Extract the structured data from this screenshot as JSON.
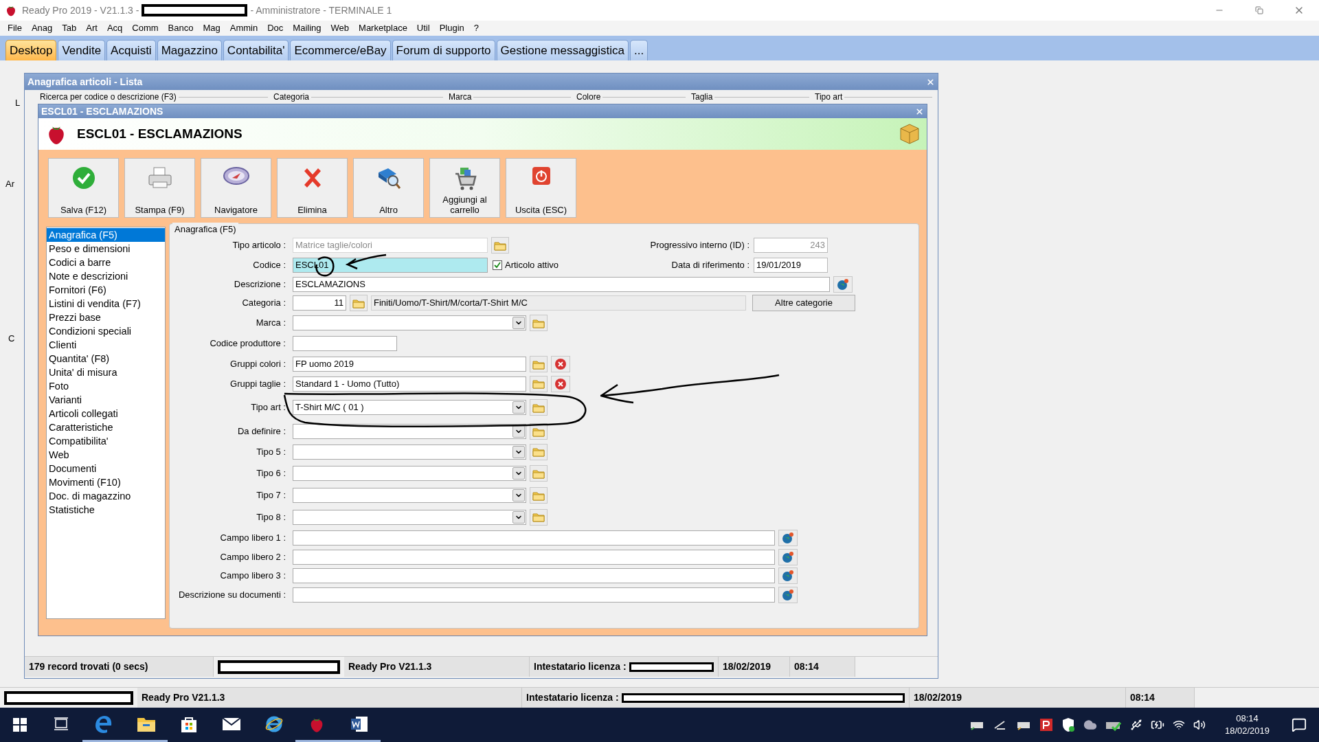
{
  "window": {
    "title_left": "Ready Pro 2019 - V21.1.3 -",
    "title_right": "- Amministratore - TERMINALE 1"
  },
  "menu": [
    "File",
    "Anag",
    "Tab",
    "Art",
    "Acq",
    "Comm",
    "Banco",
    "Mag",
    "Ammin",
    "Doc",
    "Mailing",
    "Web",
    "Marketplace",
    "Util",
    "Plugin",
    "?"
  ],
  "tabs": [
    {
      "label": "Desktop",
      "selected": true
    },
    {
      "label": "Vendite",
      "selected": false
    },
    {
      "label": "Acquisti",
      "selected": false
    },
    {
      "label": "Magazzino",
      "selected": false
    },
    {
      "label": "Contabilita'",
      "selected": false
    },
    {
      "label": "Ecommerce/eBay",
      "selected": false
    },
    {
      "label": "Forum di supporto",
      "selected": false
    },
    {
      "label": "Gestione messaggistica",
      "selected": false
    },
    {
      "label": "...",
      "selected": false
    }
  ],
  "desktop_fragments": [
    "L",
    "Ar",
    "C"
  ],
  "list_window": {
    "title": "Anagrafica articoli  - Lista",
    "filters": [
      "Ricerca per codice o descrizione (F3)",
      "Categoria",
      "Marca",
      "Colore",
      "Taglia",
      "Tipo art"
    ],
    "status": [
      {
        "kind": "text",
        "text": "179 record trovati (0 secs)"
      },
      {
        "kind": "redacted"
      },
      {
        "kind": "text",
        "text": "Ready Pro V21.1.3"
      },
      {
        "kind": "licence",
        "text": "Intestatario licenza :"
      },
      {
        "kind": "text",
        "text": "18/02/2019"
      },
      {
        "kind": "text",
        "text": "08:14"
      }
    ]
  },
  "dialog": {
    "title": "ESCL01 - ESCLAMAZIONS",
    "header": "ESCL01 - ESCLAMAZIONS",
    "toolbar": [
      {
        "kind": "save",
        "label": "Salva (F12)"
      },
      {
        "kind": "print",
        "label": "Stampa (F9)"
      },
      {
        "kind": "navigator",
        "label": "Navigatore"
      },
      {
        "kind": "delete",
        "label": "Elimina"
      },
      {
        "kind": "more",
        "label": "Altro"
      },
      {
        "kind": "cart",
        "label": "Aggiungi al carrello"
      },
      {
        "kind": "exit",
        "label": "Uscita (ESC)"
      }
    ],
    "sections": [
      {
        "label": "Anagrafica (F5)",
        "selected": true
      },
      {
        "label": "Peso e dimensioni",
        "selected": false
      },
      {
        "label": "Codici a barre",
        "selected": false
      },
      {
        "label": "Note e descrizioni",
        "selected": false
      },
      {
        "label": "Fornitori (F6)",
        "selected": false
      },
      {
        "label": "Listini di vendita (F7)",
        "selected": false
      },
      {
        "label": "Prezzi base",
        "selected": false
      },
      {
        "label": "Condizioni speciali",
        "selected": false
      },
      {
        "label": "Clienti",
        "selected": false
      },
      {
        "label": "Quantita' (F8)",
        "selected": false
      },
      {
        "label": "Unita' di misura",
        "selected": false
      },
      {
        "label": "Foto",
        "selected": false
      },
      {
        "label": "Varianti",
        "selected": false
      },
      {
        "label": "Articoli collegati",
        "selected": false
      },
      {
        "label": "Caratteristiche",
        "selected": false
      },
      {
        "label": "Compatibilita'",
        "selected": false
      },
      {
        "label": "Web",
        "selected": false
      },
      {
        "label": "Documenti",
        "selected": false
      },
      {
        "label": "Movimenti (F10)",
        "selected": false
      },
      {
        "label": "Doc. di magazzino",
        "selected": false
      },
      {
        "label": "Statistiche",
        "selected": false
      }
    ],
    "group_title": "Anagrafica (F5)",
    "fields": [
      {
        "kind": "text",
        "label": "Tipo articolo :",
        "value": "Matrice taglie/colori",
        "readonly": true,
        "focused": false,
        "buttons": [
          {
            "kind": "folder"
          }
        ]
      },
      {
        "kind": "text",
        "label": "Codice :",
        "value": "ESCL01",
        "readonly": false,
        "focused": true,
        "checkbox": {
          "label": "Articolo attivo",
          "checked": true
        }
      },
      {
        "kind": "text",
        "label": "Descrizione :",
        "value": "ESCLAMAZIONS",
        "readonly": false,
        "focused": false,
        "buttons": [
          {
            "kind": "globe"
          }
        ]
      },
      {
        "kind": "category",
        "label": "Categoria :",
        "number": "11",
        "path": "Finiti/Uomo/T-Shirt/M/corta/T-Shirt M/C",
        "action": "Altre categorie",
        "readonly": false,
        "focused": false
      },
      {
        "kind": "combo",
        "label": "Marca :",
        "readonly": false,
        "focused": false,
        "buttons": [
          {
            "kind": "folder"
          }
        ]
      },
      {
        "kind": "text",
        "label": "Codice produttore :",
        "readonly": false,
        "focused": false
      },
      {
        "kind": "text",
        "label": "Gruppi colori :",
        "value": "FP uomo 2019",
        "readonly": false,
        "focused": false,
        "buttons": [
          {
            "kind": "folder"
          },
          {
            "kind": "clear"
          }
        ]
      },
      {
        "kind": "text",
        "label": "Gruppi taglie :",
        "value": "Standard 1 - Uomo (Tutto)",
        "readonly": false,
        "focused": false,
        "buttons": [
          {
            "kind": "folder"
          },
          {
            "kind": "clear"
          }
        ]
      },
      {
        "kind": "combo",
        "label": "Tipo art :",
        "value": "T-Shirt M/C ( 01 )",
        "readonly": false,
        "focused": false,
        "buttons": [
          {
            "kind": "folder"
          }
        ]
      },
      {
        "kind": "combo",
        "label": "Da definire :",
        "readonly": false,
        "focused": false,
        "buttons": [
          {
            "kind": "folder"
          }
        ]
      },
      {
        "kind": "combo",
        "label": "Tipo 5 :",
        "readonly": false,
        "focused": false,
        "buttons": [
          {
            "kind": "folder"
          }
        ]
      },
      {
        "kind": "combo",
        "label": "Tipo 6 :",
        "readonly": false,
        "focused": false,
        "buttons": [
          {
            "kind": "folder"
          }
        ]
      },
      {
        "kind": "combo",
        "label": "Tipo 7 :",
        "readonly": false,
        "focused": false,
        "buttons": [
          {
            "kind": "folder"
          }
        ]
      },
      {
        "kind": "combo",
        "label": "Tipo 8 :",
        "readonly": false,
        "focused": false,
        "buttons": [
          {
            "kind": "folder"
          }
        ]
      },
      {
        "kind": "text",
        "label": "Campo libero 1 :",
        "readonly": false,
        "focused": false,
        "buttons": [
          {
            "kind": "globe"
          }
        ]
      },
      {
        "kind": "text",
        "label": "Campo libero 2 :",
        "readonly": false,
        "focused": false,
        "buttons": [
          {
            "kind": "globe"
          }
        ]
      },
      {
        "kind": "text",
        "label": "Campo libero 3 :",
        "readonly": false,
        "focused": false,
        "buttons": [
          {
            "kind": "globe"
          }
        ]
      },
      {
        "kind": "text",
        "label": "Descrizione su documenti :",
        "readonly": false,
        "focused": false,
        "buttons": [
          {
            "kind": "globe"
          }
        ]
      }
    ],
    "right_fields": [
      {
        "label": "Progressivo interno (ID) :",
        "value": "243",
        "readonly": true
      },
      {
        "label": "Data di riferimento :",
        "value": "19/01/2019",
        "readonly": false
      }
    ]
  },
  "status_bar": [
    {
      "kind": "redacted"
    },
    {
      "kind": "text",
      "text": "Ready Pro V21.1.3"
    },
    {
      "kind": "licence",
      "text": "Intestatario licenza :"
    },
    {
      "kind": "text",
      "text": "18/02/2019"
    },
    {
      "kind": "text",
      "text": "08:14"
    }
  ],
  "taskbar": {
    "apps": [
      {
        "kind": "taskview",
        "running": false
      },
      {
        "kind": "edge",
        "running": true
      },
      {
        "kind": "explorer",
        "running": true
      },
      {
        "kind": "store",
        "running": false
      },
      {
        "kind": "mail",
        "running": false
      },
      {
        "kind": "ie",
        "running": false
      },
      {
        "kind": "readypro",
        "running": true
      },
      {
        "kind": "word",
        "running": true
      }
    ],
    "time": "08:14",
    "date": "18/02/2019"
  }
}
